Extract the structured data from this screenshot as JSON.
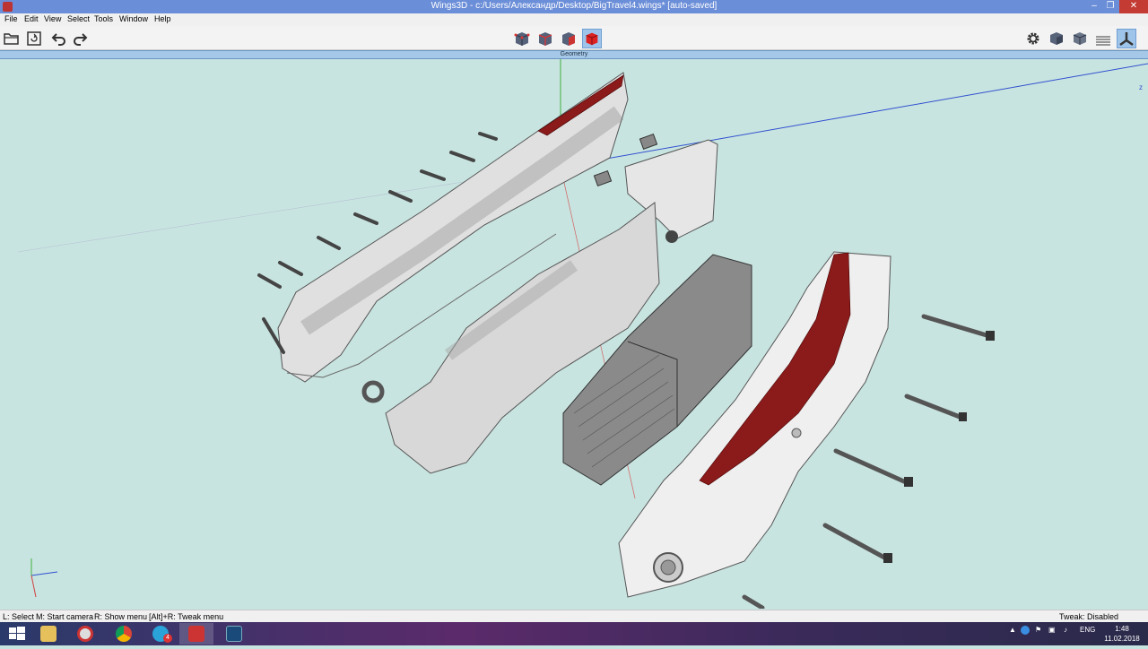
{
  "window": {
    "title": "Wings3D - c:/Users/Александр/Desktop/BigTravel4.wings* [auto-saved]",
    "controls": {
      "minimize": "–",
      "maximize": "❐",
      "close": "✕"
    }
  },
  "menu": {
    "items": [
      {
        "label": "File"
      },
      {
        "label": "Edit"
      },
      {
        "label": "View"
      },
      {
        "label": "Select"
      },
      {
        "label": "Tools"
      },
      {
        "label": "Window"
      },
      {
        "label": "Help"
      }
    ]
  },
  "toolbar": {
    "left_icons": [
      "open-folder-icon",
      "save-icon",
      "undo-icon",
      "redo-icon"
    ],
    "select_modes": [
      "vertex-mode",
      "edge-mode",
      "face-mode",
      "body-mode"
    ],
    "active_select_mode": "body-mode",
    "right_icons": [
      "settings-gear-icon",
      "smooth-shading-icon",
      "wireframe-cube-icon",
      "ground-plane-icon",
      "axes-icon"
    ]
  },
  "viewport": {
    "header": "Geometry",
    "axis_label_z": "z",
    "colors": {
      "background": "#c8e4e0",
      "axis_x": "#d04040",
      "axis_y": "#40b040",
      "axis_z": "#3050d0",
      "selection": "#8b1a1a"
    }
  },
  "status": {
    "left_select": "L: Select",
    "start_camera": "M: Start camera",
    "show_menu": "R: Show menu",
    "tweak_menu": "[Alt]+R: Tweak menu",
    "tweak_state": "Tweak: Disabled"
  },
  "taskbar": {
    "apps": [
      "windows-start",
      "file-explorer",
      "app-red-circle",
      "chrome",
      "telegram",
      "wings3d",
      "3d-app"
    ],
    "telegram_badge": "4",
    "language": "ENG",
    "time": "1:48",
    "date": "11.02.2018"
  }
}
